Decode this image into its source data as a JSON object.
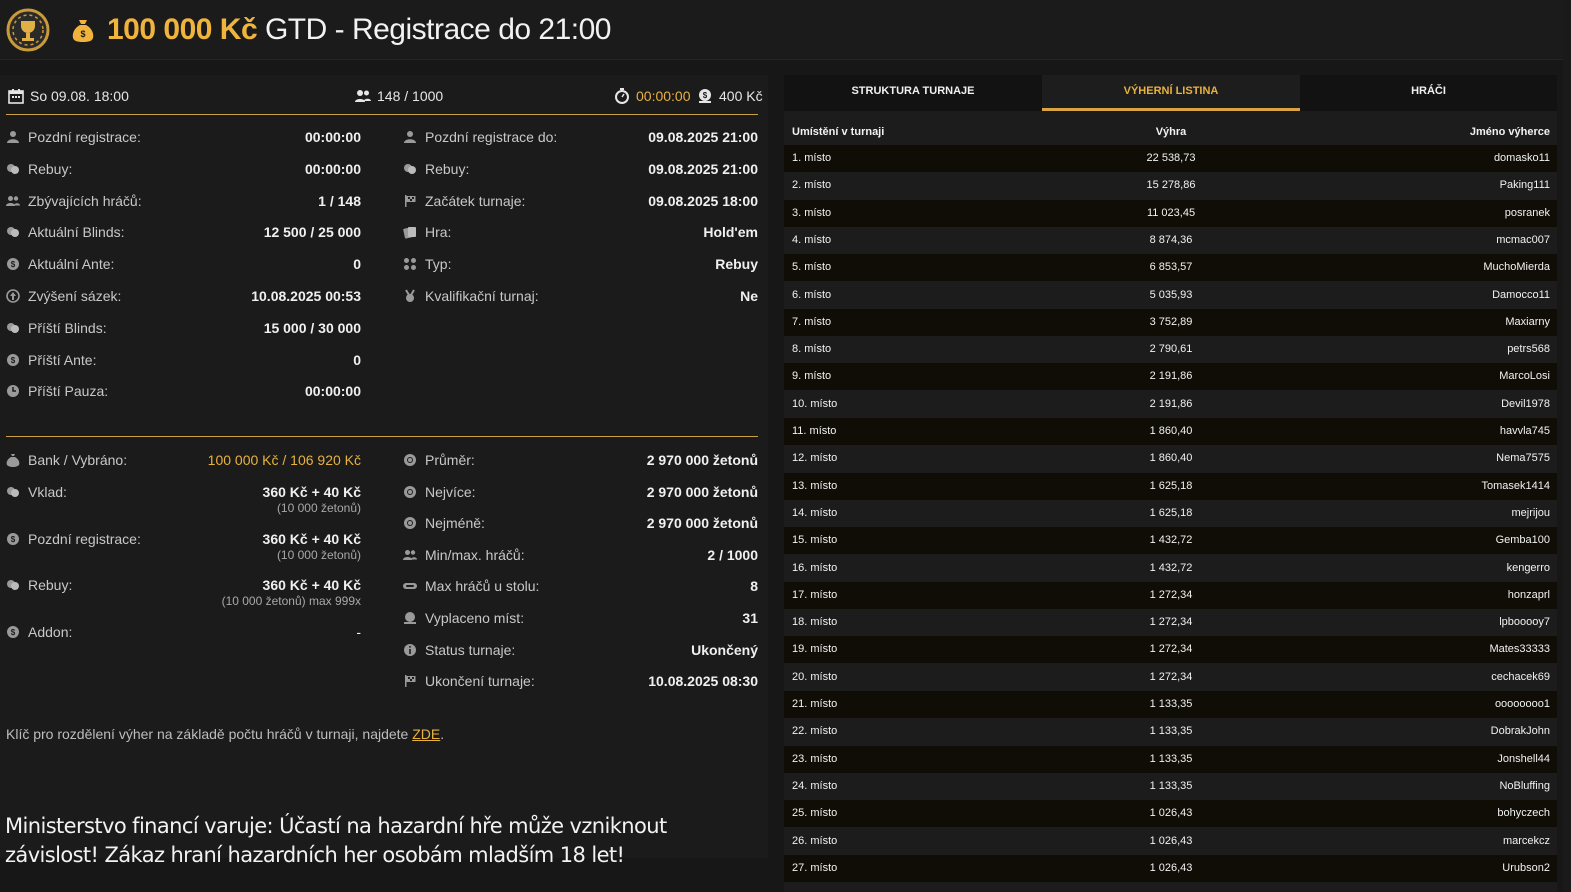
{
  "header": {
    "amount": "100 000 Kč",
    "title_rest": " GTD - Registrace do 21:00"
  },
  "topbar": {
    "date": "So 09.08. 18:00",
    "players": "148 / 1000",
    "timer": "00:00:00",
    "buyin": "400 Kč"
  },
  "left_rows": [
    {
      "label": "Pozdní registrace:",
      "value": "00:00:00",
      "icon": "user-icon"
    },
    {
      "label": "Rebuy:",
      "value": "00:00:00",
      "icon": "chips-icon"
    },
    {
      "label": "Zbývajících hráčů:",
      "value": "1 / 148",
      "icon": "users-icon"
    },
    {
      "label": "Aktuální Blinds:",
      "value": "12 500 / 25 000",
      "icon": "chips-icon"
    },
    {
      "label": "Aktuální Ante:",
      "value": "0",
      "icon": "coin-icon"
    },
    {
      "label": "Zvýšení sázek:",
      "value": "10.08.2025 00:53",
      "icon": "arrow-up-icon"
    },
    {
      "label": "Příští Blinds:",
      "value": "15 000 / 30 000",
      "icon": "chips-icon"
    },
    {
      "label": "Příští Ante:",
      "value": "0",
      "icon": "coin-icon"
    },
    {
      "label": "Příští Pauza:",
      "value": "00:00:00",
      "icon": "clock-icon"
    }
  ],
  "right_rows": [
    {
      "label": "Pozdní registrace do:",
      "value": "09.08.2025 21:00",
      "icon": "user-icon"
    },
    {
      "label": "Rebuy:",
      "value": "09.08.2025 21:00",
      "icon": "chips-icon"
    },
    {
      "label": "Začátek turnaje:",
      "value": "09.08.2025 18:00",
      "icon": "flag-icon"
    },
    {
      "label": "Hra:",
      "value": "Hold'em",
      "icon": "cards-icon"
    },
    {
      "label": "Typ:",
      "value": "Rebuy",
      "icon": "suits-icon"
    },
    {
      "label": "Kvalifikační turnaj:",
      "value": "Ne",
      "icon": "medal-icon"
    }
  ],
  "bank": {
    "bank_label": "Bank / Vybráno:",
    "bank_value": "100 000 Kč / 106 920 Kč",
    "vklad_label": "Vklad:",
    "vklad_value": "360 Kč + 40 Kč",
    "vklad_sub": "(10 000 žetonů)",
    "late_label": "Pozdní registrace:",
    "late_value": "360 Kč + 40 Kč",
    "late_sub": "(10 000 žetonů)",
    "rebuy_label": "Rebuy:",
    "rebuy_value": "360 Kč + 40 Kč",
    "rebuy_sub": "(10 000 žetonů) max 999x",
    "addon_label": "Addon:",
    "addon_value": "-"
  },
  "stats": [
    {
      "label": "Průměr:",
      "value": "2 970 000 žetonů",
      "icon": "chip-icon"
    },
    {
      "label": "Nejvíce:",
      "value": "2 970 000 žetonů",
      "icon": "chip-icon"
    },
    {
      "label": "Nejméně:",
      "value": "2 970 000 žetonů",
      "icon": "chip-icon"
    },
    {
      "label": "Min/max. hráčů:",
      "value": "2 / 1000",
      "icon": "users-icon"
    },
    {
      "label": "Max hráčů u stolu:",
      "value": "8",
      "icon": "table-icon"
    },
    {
      "label": "Vyplaceno míst:",
      "value": "31",
      "icon": "payout-icon"
    },
    {
      "label": "Status turnaje:",
      "value": "Ukončený",
      "icon": "info-icon"
    },
    {
      "label": "Ukončení turnaje:",
      "value": "10.08.2025 08:30",
      "icon": "flag-icon"
    }
  ],
  "key_text": "Klíč pro rozdělení výher na základě počtu hráčů v turnaji, najdete ",
  "key_link": "ZDE",
  "key_end": ".",
  "warning": "Ministerstvo financí varuje: Účastí na hazardní hře může vzniknout závislost! Zákaz hraní hazardních her osobám mladším 18 let!",
  "tabs": [
    "STRUKTURA TURNAJE",
    "VÝHERNÍ LISTINA",
    "HRÁČI"
  ],
  "table": {
    "headers": [
      "Umístění v turnaji",
      "Výhra",
      "Jméno výherce"
    ],
    "rows": [
      [
        "1. místo",
        "22 538,73",
        "domasko11"
      ],
      [
        "2. místo",
        "15 278,86",
        "Paking111"
      ],
      [
        "3. místo",
        "11 023,45",
        "posranek"
      ],
      [
        "4. místo",
        "8 874,36",
        "mcmac007"
      ],
      [
        "5. místo",
        "6 853,57",
        "MuchoMierda"
      ],
      [
        "6. místo",
        "5 035,93",
        "Damocco11"
      ],
      [
        "7. místo",
        "3 752,89",
        "Maxiarny"
      ],
      [
        "8. místo",
        "2 790,61",
        "petrs568"
      ],
      [
        "9. místo",
        "2 191,86",
        "MarcoLosi"
      ],
      [
        "10. místo",
        "2 191,86",
        "Devil1978"
      ],
      [
        "11. místo",
        "1 860,40",
        "havvla745"
      ],
      [
        "12. místo",
        "1 860,40",
        "Nema7575"
      ],
      [
        "13. místo",
        "1 625,18",
        "Tomasek1414"
      ],
      [
        "14. místo",
        "1 625,18",
        "mejrijou"
      ],
      [
        "15. místo",
        "1 432,72",
        "Gemba100"
      ],
      [
        "16. místo",
        "1 432,72",
        "kengerro"
      ],
      [
        "17. místo",
        "1 272,34",
        "honzaprl"
      ],
      [
        "18. místo",
        "1 272,34",
        "lpbooooy7"
      ],
      [
        "19. místo",
        "1 272,34",
        "Mates33333"
      ],
      [
        "20. místo",
        "1 272,34",
        "cechacek69"
      ],
      [
        "21. místo",
        "1 133,35",
        "oooooooo1"
      ],
      [
        "22. místo",
        "1 133,35",
        "DobrakJohn"
      ],
      [
        "23. místo",
        "1 133,35",
        "Jonshell44"
      ],
      [
        "24. místo",
        "1 133,35",
        "NoBluffing"
      ],
      [
        "25. místo",
        "1 026,43",
        "bohyczech"
      ],
      [
        "26. místo",
        "1 026,43",
        "marcekcz"
      ],
      [
        "27. místo",
        "1 026,43",
        "Urubson2"
      ]
    ]
  }
}
